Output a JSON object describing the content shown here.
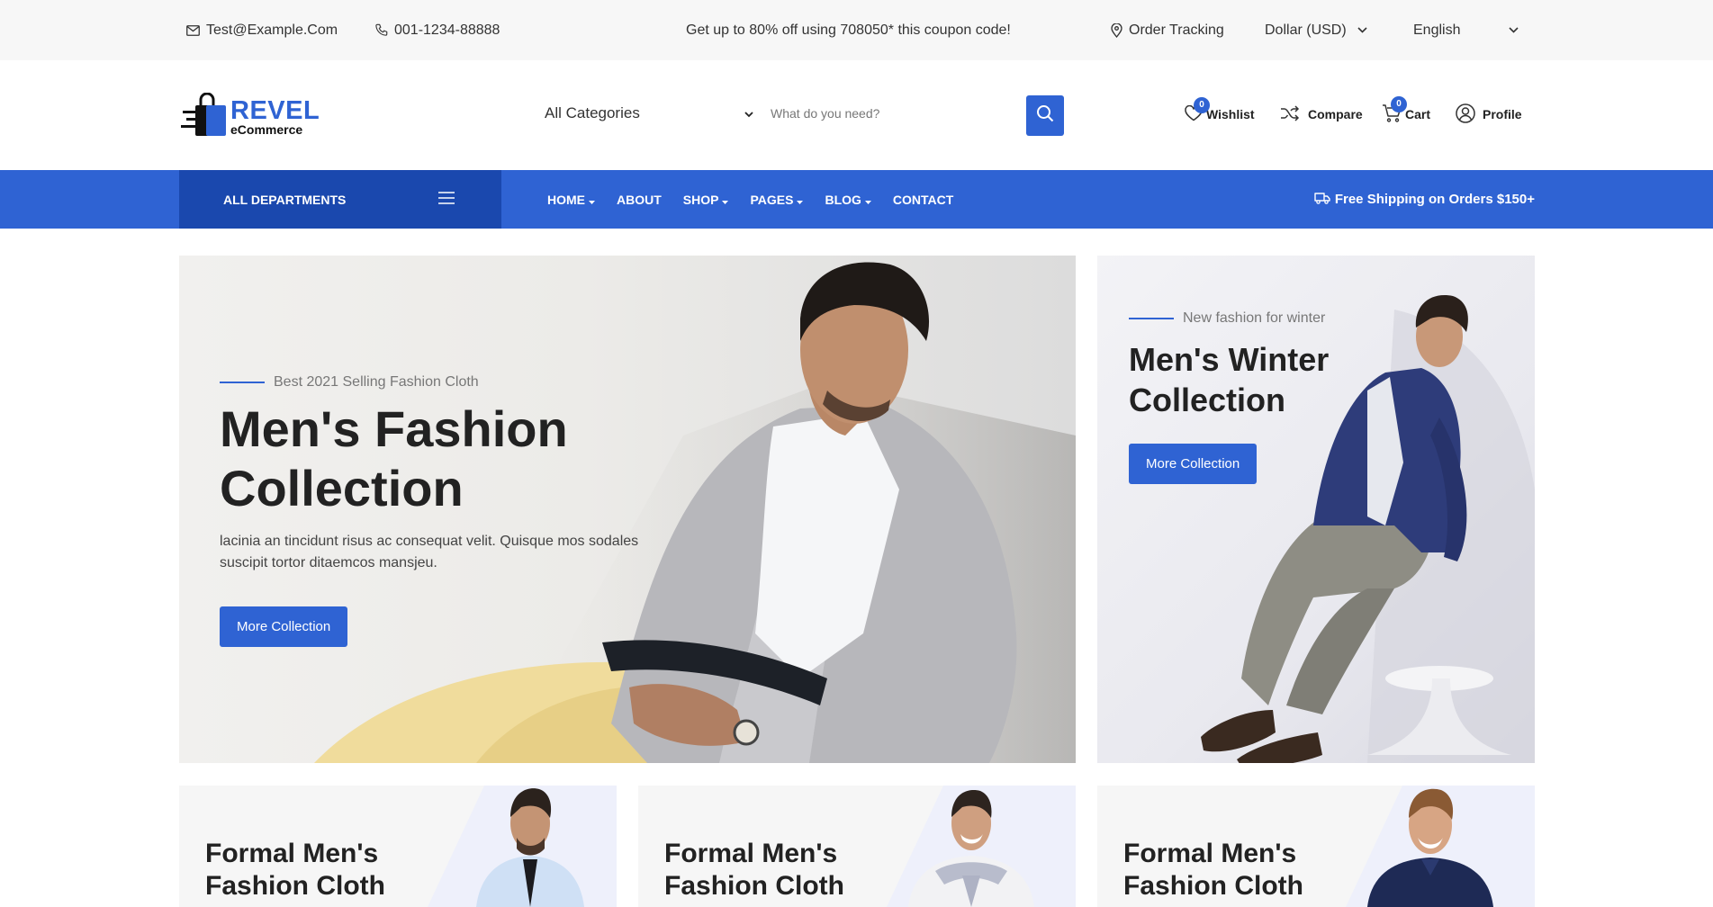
{
  "topbar": {
    "email": "Test@Example.Com",
    "phone": "001-1234-88888",
    "coupon": "Get up to 80% off using 708050* this coupon code!",
    "order_tracking": "Order Tracking",
    "currency": "Dollar (USD)",
    "language": "English"
  },
  "header": {
    "logo_brand": "REVEL",
    "logo_sub": "eCommerce",
    "category_select": "All Categories",
    "search_placeholder": "What do you need?",
    "wishlist_label": "Wishlist",
    "wishlist_count": "0",
    "compare_label": "Compare",
    "cart_label": "Cart",
    "cart_count": "0",
    "profile_label": "Profile"
  },
  "nav": {
    "departments": "ALL DEPARTMENTS",
    "items": [
      {
        "label": "HOME",
        "dropdown": true
      },
      {
        "label": "ABOUT",
        "dropdown": false
      },
      {
        "label": "SHOP",
        "dropdown": true
      },
      {
        "label": "PAGES",
        "dropdown": true
      },
      {
        "label": "BLOG",
        "dropdown": true
      },
      {
        "label": "CONTACT",
        "dropdown": false
      }
    ],
    "shipping": "Free Shipping on Orders $150+"
  },
  "hero": {
    "eyebrow": "Best 2021 Selling Fashion Cloth",
    "title": "Men's Fashion Collection",
    "description": "lacinia an tincidunt risus ac consequat velit. Quisque mos sodales suscipit tortor ditaemcos mansjeu.",
    "button": "More Collection"
  },
  "side_banner": {
    "eyebrow": "New fashion for winter",
    "title": "Men's Winter Collection",
    "button": "More Collection"
  },
  "cards": [
    {
      "title": "Formal Men's Fashion Cloth"
    },
    {
      "title": "Formal Men's Fashion Cloth"
    },
    {
      "title": "Formal Men's Fashion Cloth"
    }
  ],
  "colors": {
    "accent": "#2f63d3",
    "accent_dark": "#1a48ae",
    "topbar_bg": "#f7f7f7"
  }
}
